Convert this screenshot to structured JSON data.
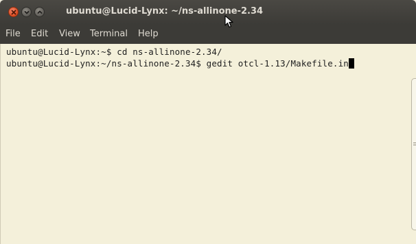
{
  "window": {
    "title": "ubuntu@Lucid-Lynx: ~/ns-allinone-2.34",
    "controls": {
      "close_icon": "close-icon",
      "minimize_icon": "minimize-icon",
      "maximize_icon": "maximize-icon"
    }
  },
  "menubar": {
    "items": [
      {
        "label": "File"
      },
      {
        "label": "Edit"
      },
      {
        "label": "View"
      },
      {
        "label": "Terminal"
      },
      {
        "label": "Help"
      }
    ]
  },
  "terminal": {
    "lines": [
      "ubuntu@Lucid-Lynx:~$ cd ns-allinone-2.34/",
      "ubuntu@Lucid-Lynx:~/ns-allinone-2.34$ gedit otcl-1.13/Makefile.in"
    ]
  },
  "colors": {
    "titlebar": "#3c3b37",
    "close_button": "#d94a1f",
    "terminal_background": "#f4f0da",
    "terminal_text": "#1e1e1e"
  }
}
